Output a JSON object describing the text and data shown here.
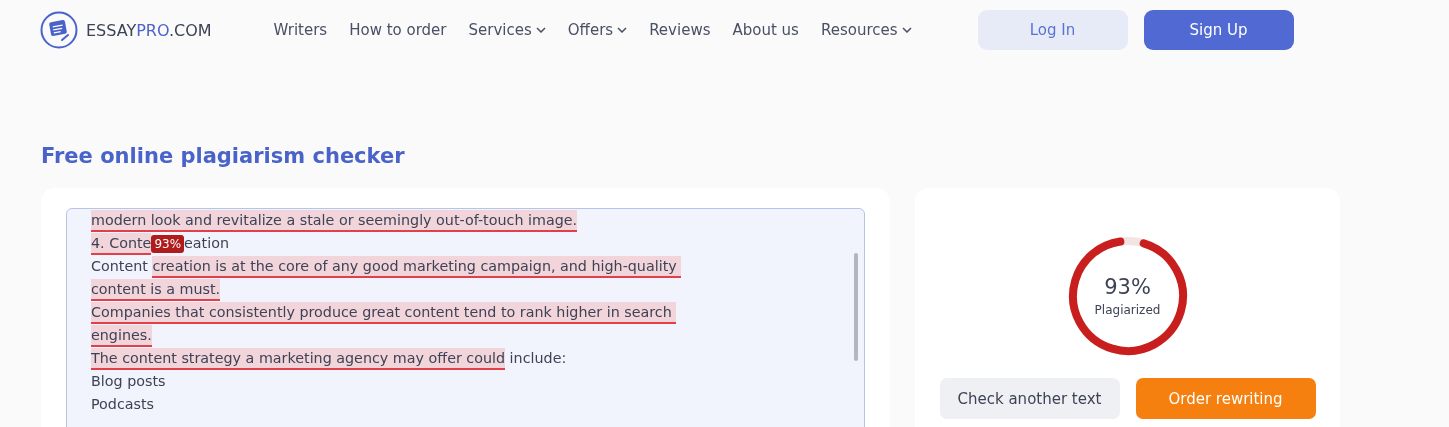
{
  "header": {
    "logo": {
      "part1": "ESSAY",
      "part2": "PRO",
      "part3": ".COM"
    },
    "nav": [
      {
        "label": "Writers",
        "dropdown": false
      },
      {
        "label": "How to order",
        "dropdown": false
      },
      {
        "label": "Services",
        "dropdown": true
      },
      {
        "label": "Offers",
        "dropdown": true
      },
      {
        "label": "Reviews",
        "dropdown": false
      },
      {
        "label": "About us",
        "dropdown": false
      },
      {
        "label": "Resources",
        "dropdown": true
      }
    ],
    "login": "Log In",
    "signup": "Sign Up"
  },
  "title": "Free online plagiarism checker",
  "editor": {
    "lines": [
      [
        {
          "kind": "text",
          "text": "modern look and revitalize a stale or seemingly out-of-touch image.",
          "highlighted": true
        }
      ],
      [
        {
          "kind": "text",
          "text": "4. Conte",
          "highlighted": true
        },
        {
          "kind": "badge",
          "text": "93%"
        },
        {
          "kind": "text",
          "text": "eation",
          "highlighted": false
        }
      ],
      [
        {
          "kind": "text",
          "text": "Content ",
          "highlighted": false
        },
        {
          "kind": "text",
          "text": "creation is at the core of any good marketing campaign, and high-quality ",
          "highlighted": true
        }
      ],
      [
        {
          "kind": "text",
          "text": "content is a must.",
          "highlighted": true
        }
      ],
      [
        {
          "kind": "text",
          "text": "Companies that consistently produce great content tend to rank higher in search ",
          "highlighted": true
        }
      ],
      [
        {
          "kind": "text",
          "text": "engines.",
          "highlighted": true
        }
      ],
      [
        {
          "kind": "text",
          "text": "The content strategy a marketing agency may offer could",
          "highlighted": true
        },
        {
          "kind": "text",
          "text": " include:",
          "highlighted": false
        }
      ],
      [
        {
          "kind": "text",
          "text": "Blog posts",
          "highlighted": false
        }
      ],
      [
        {
          "kind": "text",
          "text": "Podcasts",
          "highlighted": false
        }
      ]
    ]
  },
  "result": {
    "percent": "93%",
    "label": "Plagiarized",
    "level": 0.93,
    "check_button": "Check another text",
    "order_button": "Order rewriting"
  }
}
